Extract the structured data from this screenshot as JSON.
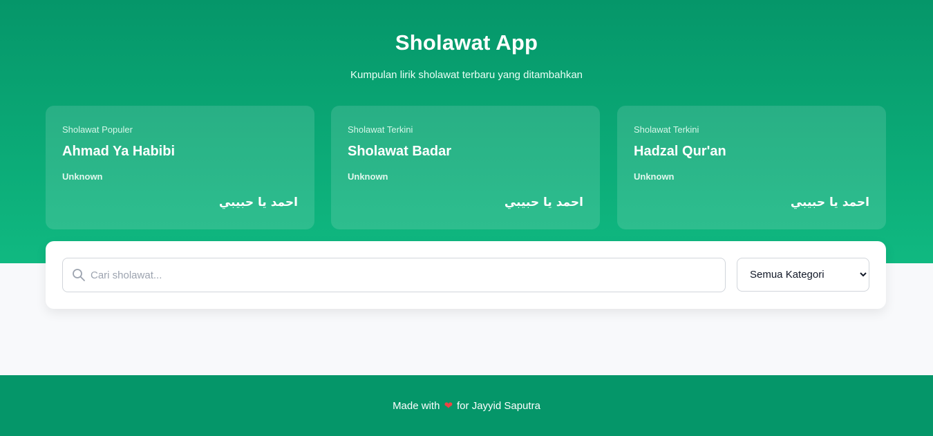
{
  "header": {
    "title": "Sholawat App",
    "subtitle": "Kumpulan lirik sholawat terbaru yang ditambahkan"
  },
  "cards": [
    {
      "category": "Sholawat Populer",
      "title": "Ahmad Ya Habibi",
      "author": "Unknown",
      "arabic": "احمد يا حبيبي"
    },
    {
      "category": "Sholawat Terkini",
      "title": "Sholawat Badar",
      "author": "Unknown",
      "arabic": "احمد يا حبيبي"
    },
    {
      "category": "Sholawat Terkini",
      "title": "Hadzal Qur'an",
      "author": "Unknown",
      "arabic": "احمد يا حبيبي"
    }
  ],
  "search": {
    "placeholder": "Cari sholawat...",
    "value": "",
    "icon": "search-icon"
  },
  "category_filter": {
    "selected": "Semua Kategori"
  },
  "footer": {
    "prefix": "Made with",
    "heart_icon": "heart-icon",
    "suffix": "for Jayyid Saputra"
  },
  "colors": {
    "primary": "#059669",
    "primary_light": "#10b981",
    "background": "#f8f9fb",
    "heart": "#ef4444"
  }
}
